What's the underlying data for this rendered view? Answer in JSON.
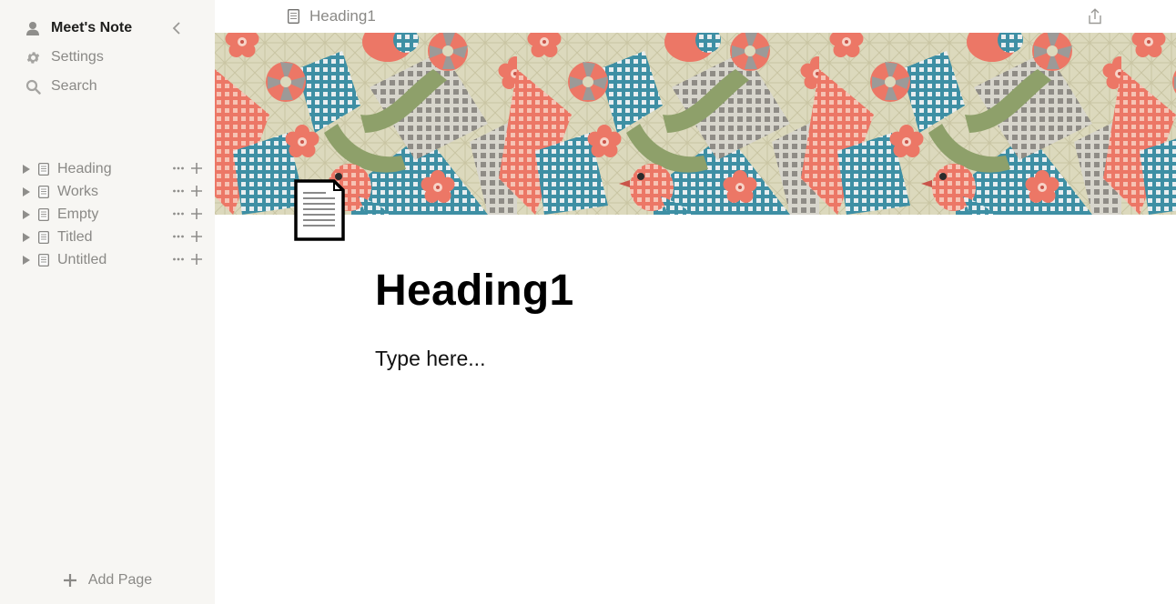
{
  "sidebar": {
    "user_name": "Meet's Note",
    "settings_label": "Settings",
    "search_label": "Search",
    "pages": [
      {
        "label": "Heading"
      },
      {
        "label": "Works"
      },
      {
        "label": "Empty"
      },
      {
        "label": "Titled"
      },
      {
        "label": "Untitled"
      }
    ],
    "add_page_label": "Add Page"
  },
  "topbar": {
    "breadcrumb": "Heading1"
  },
  "page": {
    "title": "Heading1",
    "body": "Type here..."
  },
  "colors": {
    "sidebar_bg": "#f7f6f3",
    "muted_text": "#8a8986",
    "cover_coral": "#ec7766",
    "cover_teal": "#3e8fa4",
    "cover_olive": "#8ea06a",
    "cover_beige": "#dcd9bd"
  },
  "icons": {
    "user": "person-icon",
    "settings": "gear-icon",
    "search": "search-icon",
    "collapse": "chevron-left-icon",
    "page": "document-icon",
    "share": "share-icon",
    "add": "plus-icon"
  }
}
